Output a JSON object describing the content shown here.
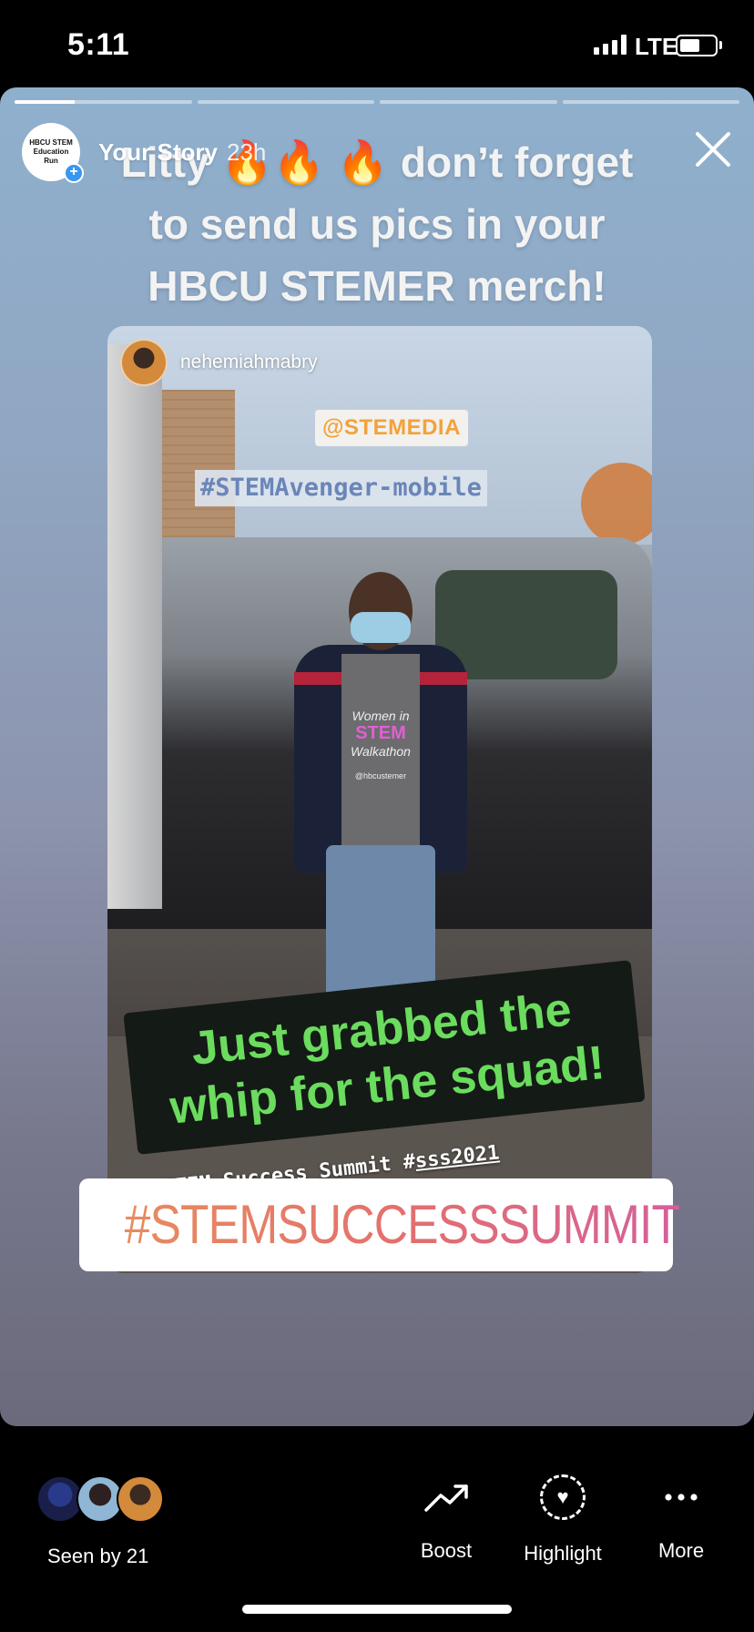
{
  "status_bar": {
    "time": "5:11",
    "network": "LTE",
    "signal_bars": 4,
    "battery_level": 0.55
  },
  "story": {
    "progress": [
      1.0,
      0.0,
      0.0,
      0.0
    ],
    "progress_current_fill": 0.34,
    "account_avatar_text": "HBCU STEM Education Run",
    "user": "Your Story",
    "time": "23h",
    "caption_line1": "Litty 🔥🔥 🔥 don’t forget",
    "caption_line2": "to send us pics in your",
    "caption_line3": "HBCU STEMER merch!",
    "close_icon": "close-icon"
  },
  "post": {
    "username": "nehemiahmabry",
    "mention": "@STEMEDIA",
    "hashtag": "#STEMAvenger-mobile",
    "shirt_line1": "Women in",
    "shirt_line2": "STEM",
    "shirt_line3": "Walkathon",
    "shirt_handle": "@hbcustemer",
    "green_line1": "Just grabbed the",
    "green_line2": "whip for the squad!",
    "subtitle_prefix": "STEM Success Summit #",
    "subtitle_tag": "sss2021"
  },
  "summit_sticker": "#STEMSUCCESSSUMMIT",
  "bottom_bar": {
    "seen_label": "Seen by 21",
    "boost_label": "Boost",
    "highlight_label": "Highlight",
    "more_label": "More"
  },
  "colors": {
    "progress_fill": "#ffffff",
    "green_sticker_text": "#6bdc5e",
    "mention_text": "#f2a23a",
    "hashtag_text": "#6a86b8",
    "summit_gradient_start": "#e78c5f",
    "summit_gradient_end": "#d4609a",
    "plus_badge": "#3897f0"
  }
}
